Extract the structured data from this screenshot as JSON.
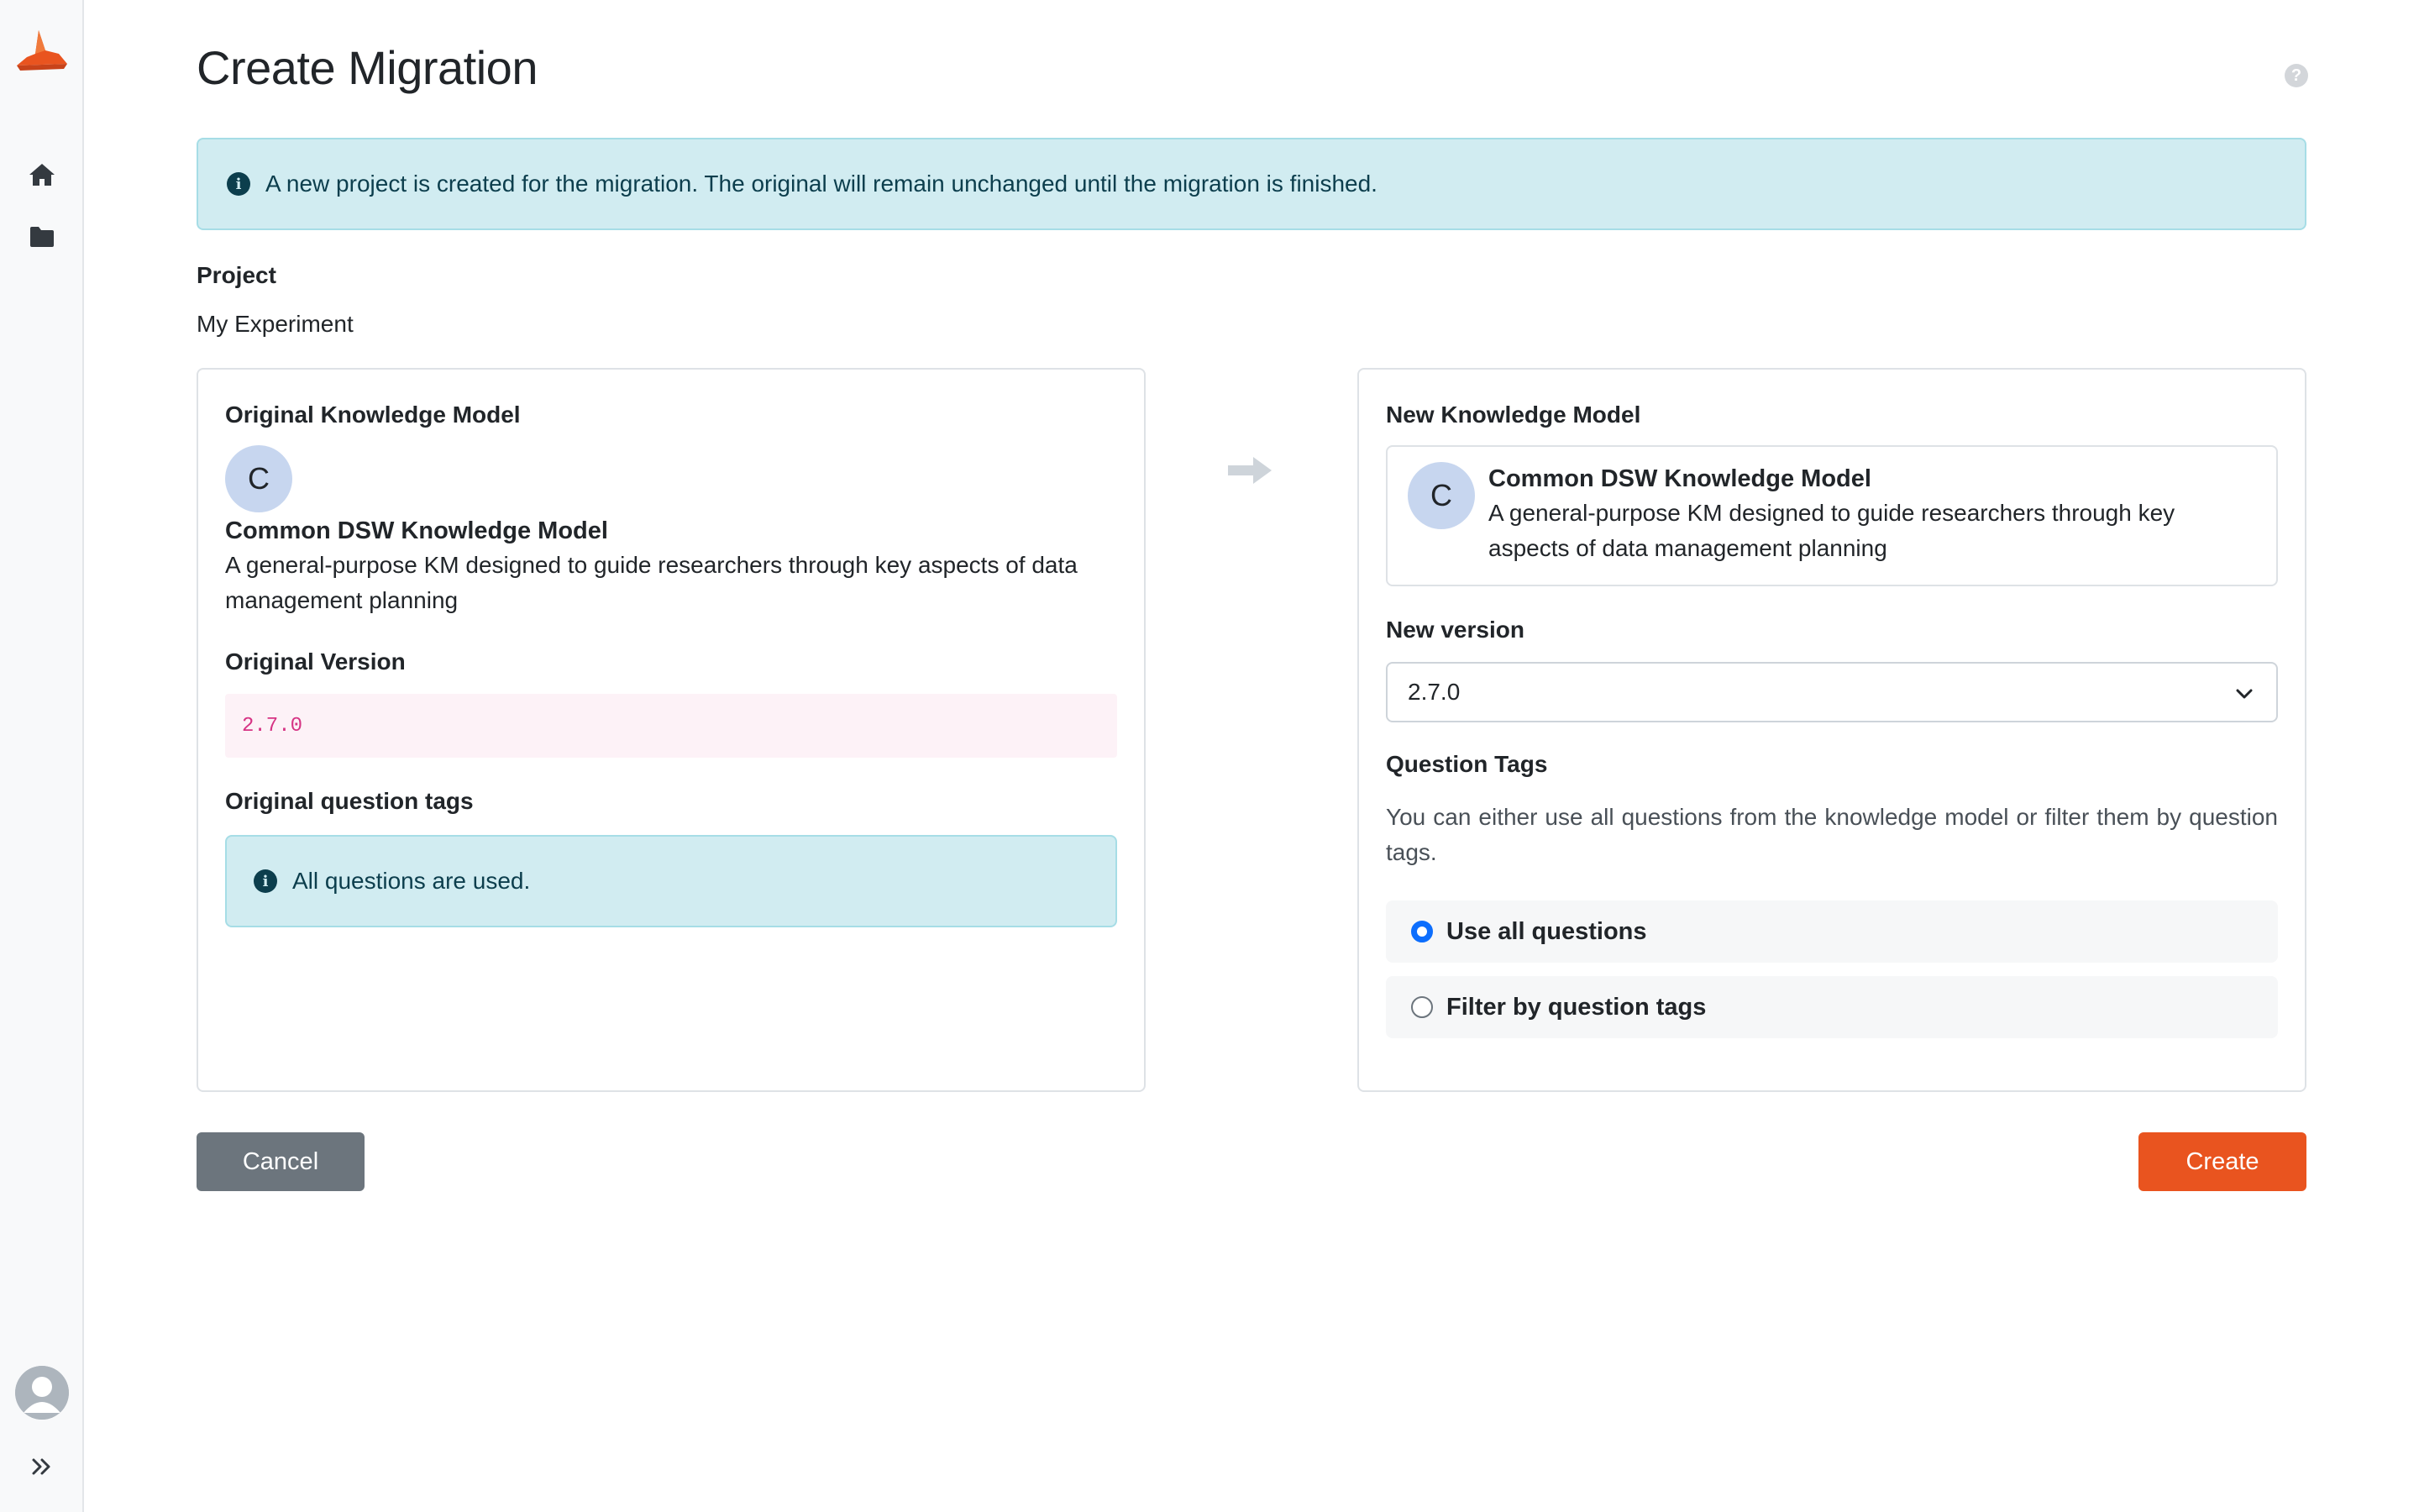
{
  "sidebar": {
    "logo_icon": "wizard-hat-logo",
    "items": [
      {
        "icon": "home-icon"
      },
      {
        "icon": "folder-icon"
      }
    ],
    "avatar_icon": "user-avatar",
    "expand_icon": "double-chevron-right-icon"
  },
  "page": {
    "title": "Create Migration",
    "help_icon": "?"
  },
  "info_alert": {
    "icon": "i",
    "text": "A new project is created for the migration. The original will remain unchanged until the migration is finished."
  },
  "project": {
    "label": "Project",
    "value": "My Experiment"
  },
  "original": {
    "heading": "Original Knowledge Model",
    "km": {
      "initial": "C",
      "name": "Common DSW Knowledge Model",
      "description_line1": "A general-purpose KM designed to guide researchers through key aspects of data",
      "description_line2": "management planning"
    },
    "version_label": "Original Version",
    "version_value": "2.7.0",
    "tags_label": "Original question tags",
    "tags_alert": {
      "icon": "i",
      "text": "All questions are used."
    }
  },
  "new": {
    "heading": "New Knowledge Model",
    "km": {
      "initial": "C",
      "name": "Common DSW Knowledge Model",
      "description_line1": "A general-purpose KM designed to guide researchers through key",
      "description_line2": "aspects of data management planning"
    },
    "version_label": "New version",
    "version_selected": "2.7.0",
    "tags_label": "Question Tags",
    "tags_help": "You can either use all questions from the knowledge model or filter them by question tags.",
    "options": [
      {
        "label": "Use all questions",
        "checked": true
      },
      {
        "label": "Filter by question tags",
        "checked": false
      }
    ]
  },
  "actions": {
    "cancel": "Cancel",
    "create": "Create"
  },
  "colors": {
    "accent": "#e9541f",
    "info_bg": "#d1ecf1",
    "secondary": "#6c757d",
    "radio_checked": "#0d6efd"
  }
}
